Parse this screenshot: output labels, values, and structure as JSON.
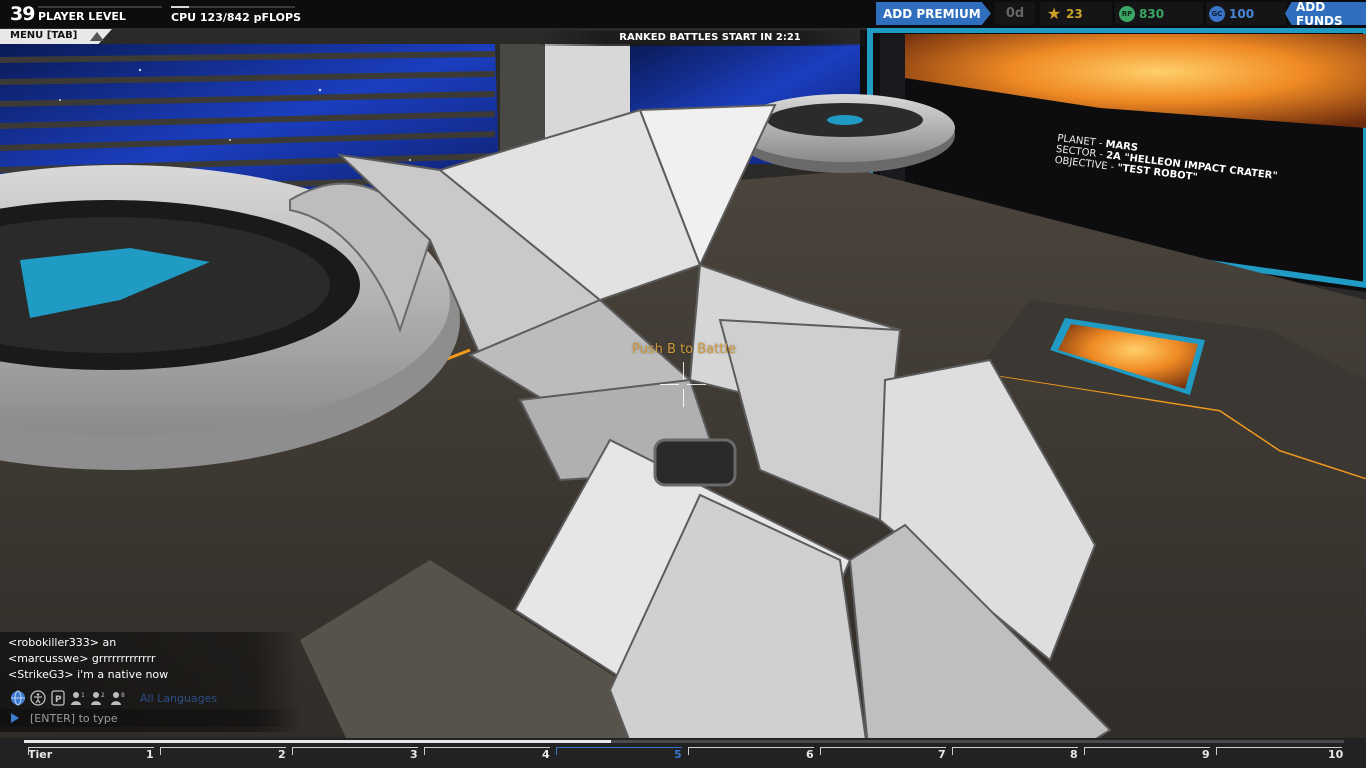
{
  "hud": {
    "player_level": "39",
    "player_level_label": "PLAYER LEVEL",
    "cpu_label": "CPU 123/842 pFLOPS",
    "cpu_fraction": 0.146,
    "add_premium_label": "ADD PREMIUM",
    "premium_days": "0d",
    "currencies": [
      {
        "icon": "star-icon",
        "value": "23",
        "color": "#c9a227"
      },
      {
        "icon": "robit-icon",
        "value": "830",
        "color": "#3aa564",
        "glyph": "RP"
      },
      {
        "icon": "galaxy-coin-icon",
        "value": "100",
        "color": "#3a73c8",
        "glyph": "GC"
      }
    ],
    "add_funds_label": "ADD FUNDS",
    "menu_label": "MENU [TAB]",
    "ranked_countdown": "RANKED BATTLES START IN 2:21"
  },
  "monitor": {
    "planet_key": "PLANET - ",
    "planet_val": "MARS",
    "sector_key": "SECTOR - ",
    "sector_val": "2A \"HELLEON IMPACT CRATER\"",
    "objective_key": "OBJECTIVE - ",
    "objective_val": "\"TEST ROBOT\""
  },
  "center": {
    "battle_prompt": "Push B to Battle"
  },
  "chat": {
    "messages": [
      {
        "text": "<robokiller333> an"
      },
      {
        "text": "<marcusswe> grrrrrrrrrrrrr"
      },
      {
        "text": "<StrikeG3> i'm a native now"
      }
    ],
    "filters": [
      "globe-icon",
      "accessibility-icon",
      "party-icon",
      "friend-one-icon",
      "friend-two-icon",
      "friend-three-icon"
    ],
    "language": "All Languages",
    "input_placeholder": "[ENTER] to type"
  },
  "tiers": {
    "label": "Tier",
    "items": [
      "1",
      "2",
      "3",
      "4",
      "5",
      "6",
      "7",
      "8",
      "9",
      "10"
    ],
    "current": "5",
    "progress_fraction": 0.445,
    "accent": "#3a73c8"
  },
  "colors": {
    "premium_blue": "#2f6fbd",
    "prompt_orange": "#d29a3a",
    "cyan_accent": "#1f9bc4",
    "orange_trim": "#f29a1d"
  }
}
